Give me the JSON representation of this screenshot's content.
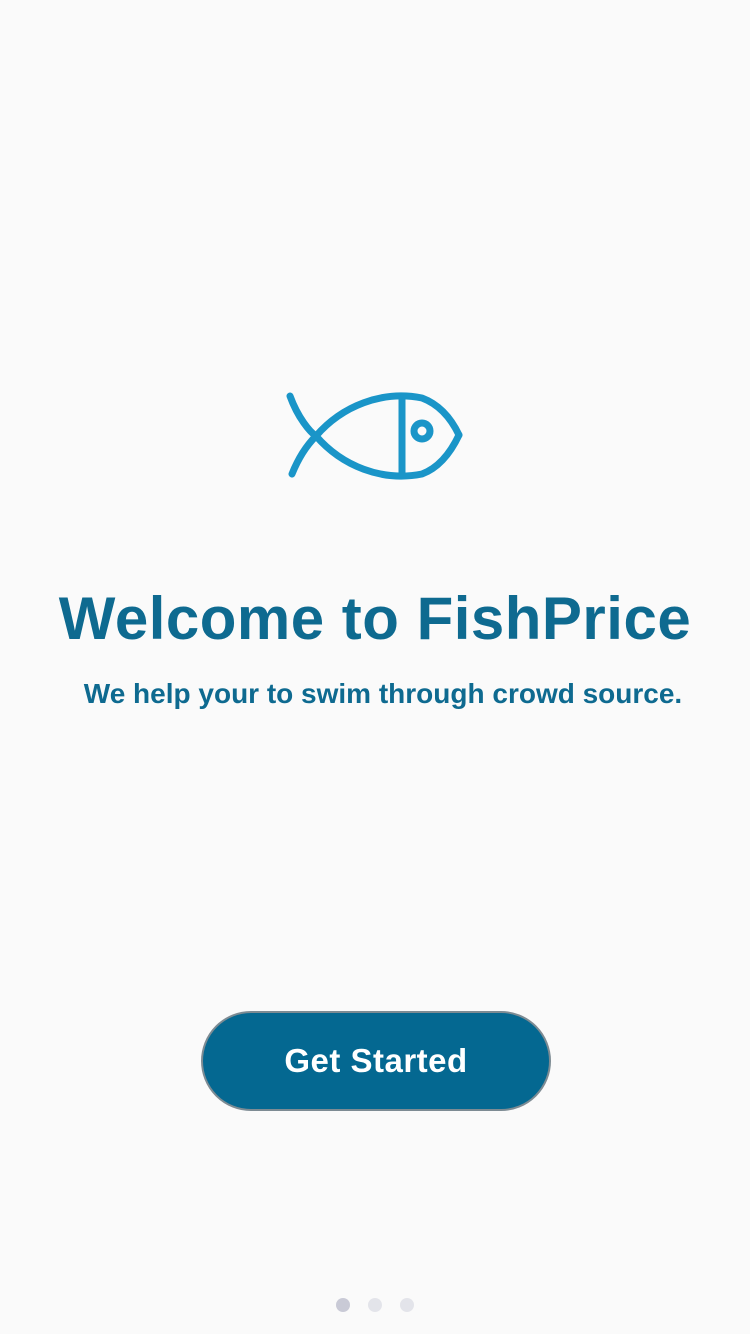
{
  "app": {
    "logo_icon": "fish-icon",
    "brand_color": "#0e6a90",
    "logo_color": "#1a95c8"
  },
  "onboarding": {
    "title": "Welcome to FishPrice",
    "subtitle": "We help your to swim through crowd source.",
    "cta_label": "Get Started",
    "page_indicator": {
      "total": 3,
      "current": 1
    }
  }
}
